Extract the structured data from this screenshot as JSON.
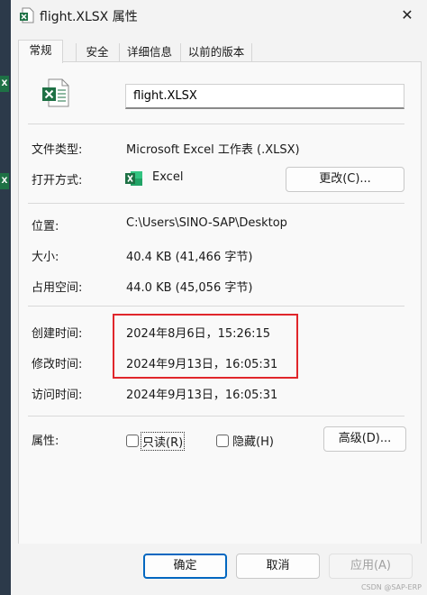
{
  "window": {
    "title": "flight.XLSX 属性",
    "close_glyph": "✕"
  },
  "tabs": [
    {
      "label": "常规",
      "active": true
    },
    {
      "label": "安全",
      "active": false
    },
    {
      "label": "详细信息",
      "active": false
    },
    {
      "label": "以前的版本",
      "active": false
    }
  ],
  "file": {
    "name": "flight.XLSX",
    "icon": "excel-file-icon"
  },
  "rows": {
    "type": {
      "label": "文件类型:",
      "value": "Microsoft Excel 工作表 (.XLSX)"
    },
    "open_with": {
      "label": "打开方式:",
      "app": "Excel",
      "app_icon": "excel-app-icon",
      "change_button": "更改(C)..."
    },
    "location": {
      "label": "位置:",
      "value": "C:\\Users\\SINO-SAP\\Desktop"
    },
    "size": {
      "label": "大小:",
      "value": "40.4 KB (41,466 字节)"
    },
    "size_on_disk": {
      "label": "占用空间:",
      "value": "44.0 KB (45,056 字节)"
    },
    "created": {
      "label": "创建时间:",
      "value": "2024年8月6日，15:26:15"
    },
    "modified": {
      "label": "修改时间:",
      "value": "2024年9月13日，16:05:31"
    },
    "accessed": {
      "label": "访问时间:",
      "value": "2024年9月13日，16:05:31"
    },
    "attributes": {
      "label": "属性:",
      "readonly": "只读(R)",
      "hidden": "隐藏(H)",
      "advanced_button": "高级(D)...",
      "readonly_checked": false,
      "hidden_checked": false
    }
  },
  "footer": {
    "ok": "确定",
    "cancel": "取消",
    "apply": "应用(A)",
    "watermark": "CSDN @SAP-ERP"
  },
  "colors": {
    "excel_green": "#1e7145",
    "highlight_red": "#e0262b",
    "accent_blue": "#0067c0"
  }
}
